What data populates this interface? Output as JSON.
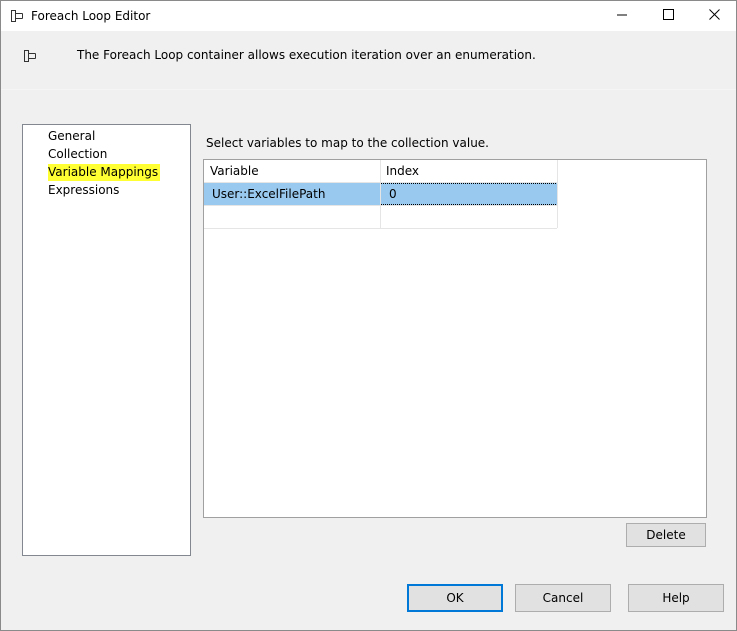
{
  "window": {
    "title": "Foreach Loop Editor",
    "title_icon": "foreach-loop-icon",
    "controls": [
      "minimize-icon",
      "maximize-icon",
      "close-icon"
    ]
  },
  "header": {
    "icon": "foreach-loop-icon",
    "description": "The Foreach Loop container allows execution iteration over an enumeration."
  },
  "nav": {
    "items": [
      {
        "label": "General"
      },
      {
        "label": "Collection"
      },
      {
        "label": "Variable Mappings",
        "selected": true
      },
      {
        "label": "Expressions"
      }
    ],
    "highlight_color": "#ffff33"
  },
  "mappings": {
    "caption": "Select variables to map to the collection value.",
    "columns": [
      "Variable",
      "Index"
    ],
    "rows": [
      {
        "variable": "User::ExcelFilePath",
        "index": "0",
        "selected": true
      },
      {
        "variable": "",
        "index": ""
      }
    ],
    "selection_color": "#99c9ef"
  },
  "buttons": {
    "delete": "Delete",
    "ok": "OK",
    "cancel": "Cancel",
    "help": "Help"
  },
  "colors": {
    "accent": "#0078d7"
  }
}
